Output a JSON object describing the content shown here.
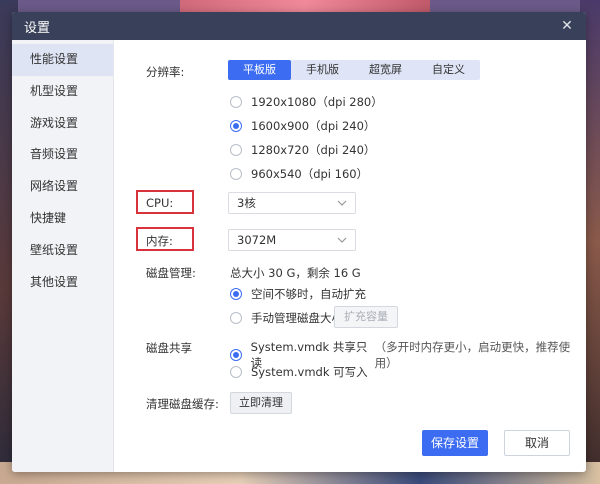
{
  "window": {
    "title": "设置"
  },
  "sidebar": {
    "items": [
      {
        "label": "性能设置"
      },
      {
        "label": "机型设置"
      },
      {
        "label": "游戏设置"
      },
      {
        "label": "音频设置"
      },
      {
        "label": "网络设置"
      },
      {
        "label": "快捷键"
      },
      {
        "label": "壁纸设置"
      },
      {
        "label": "其他设置"
      }
    ],
    "active_index": 0
  },
  "resolution": {
    "label": "分辨率:",
    "tabs": [
      "平板版",
      "手机版",
      "超宽屏",
      "自定义"
    ],
    "active_tab": 0,
    "options": [
      {
        "label": "1920x1080（dpi 280）",
        "checked": false
      },
      {
        "label": "1600x900（dpi 240）",
        "checked": true
      },
      {
        "label": "1280x720（dpi 240）",
        "checked": false
      },
      {
        "label": "960x540（dpi 160）",
        "checked": false
      }
    ]
  },
  "cpu": {
    "label": "CPU:",
    "value": "3核"
  },
  "memory": {
    "label": "内存:",
    "value": "3072M"
  },
  "disk": {
    "label": "磁盘管理:",
    "summary": "总大小 30 G，剩余 16 G",
    "options": [
      {
        "label": "空间不够时，自动扩充",
        "checked": true
      },
      {
        "label": "手动管理磁盘大小",
        "checked": false
      }
    ],
    "expand_button": "扩充容量"
  },
  "share": {
    "label": "磁盘共享",
    "options": [
      {
        "label": "System.vmdk 共享只读",
        "hint": "（多开时内存更小，启动更快，推荐使用）",
        "checked": true
      },
      {
        "label": "System.vmdk 可写入",
        "hint": "",
        "checked": false
      }
    ]
  },
  "cache": {
    "label": "清理磁盘缓存:",
    "button": "立即清理"
  },
  "footer": {
    "save": "保存设置",
    "cancel": "取消"
  },
  "colors": {
    "accent": "#3c6cf2",
    "titlebar": "#39415a",
    "highlight": "#d8333a"
  }
}
